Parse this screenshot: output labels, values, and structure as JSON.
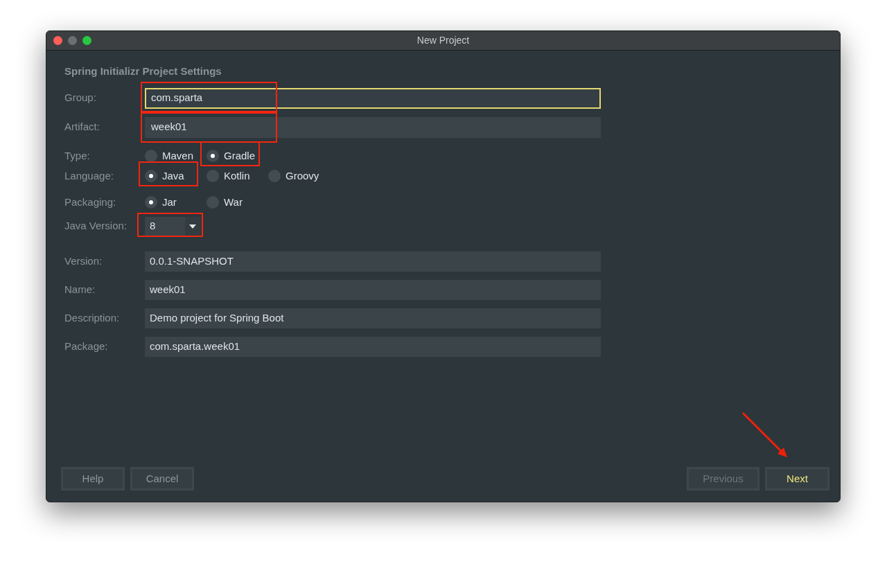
{
  "window": {
    "title": "New Project"
  },
  "heading": "Spring Initializr Project Settings",
  "top_fields": [
    {
      "label": "Group:",
      "value": "com.sparta",
      "focused": true,
      "highlighted": true
    },
    {
      "label": "Artifact:",
      "value": "week01",
      "focused": false,
      "highlighted": true
    }
  ],
  "radio_groups": [
    {
      "label": "Type:",
      "options": [
        {
          "label": "Maven",
          "selected": false,
          "highlighted": false
        },
        {
          "label": "Gradle",
          "selected": true,
          "highlighted": true
        }
      ]
    },
    {
      "label": "Language:",
      "options": [
        {
          "label": "Java",
          "selected": true,
          "highlighted": true
        },
        {
          "label": "Kotlin",
          "selected": false,
          "highlighted": false
        },
        {
          "label": "Groovy",
          "selected": false,
          "highlighted": false
        }
      ]
    },
    {
      "label": "Packaging:",
      "options": [
        {
          "label": "Jar",
          "selected": true,
          "highlighted": false
        },
        {
          "label": "War",
          "selected": false,
          "highlighted": false
        }
      ]
    }
  ],
  "java_version": {
    "label": "Java Version:",
    "value": "8",
    "highlighted": true
  },
  "fields": [
    {
      "label": "Version:",
      "value": "0.0.1-SNAPSHOT"
    },
    {
      "label": "Name:",
      "value": "week01"
    },
    {
      "label": "Description:",
      "value": "Demo project for Spring Boot"
    },
    {
      "label": "Package:",
      "value": "com.sparta.week01"
    }
  ],
  "buttons_left": [
    {
      "label": "Help",
      "disabled": false
    },
    {
      "label": "Cancel",
      "disabled": false
    }
  ],
  "buttons_right": [
    {
      "label": "Previous",
      "disabled": true,
      "default": false
    },
    {
      "label": "Next",
      "disabled": false,
      "default": true
    }
  ]
}
